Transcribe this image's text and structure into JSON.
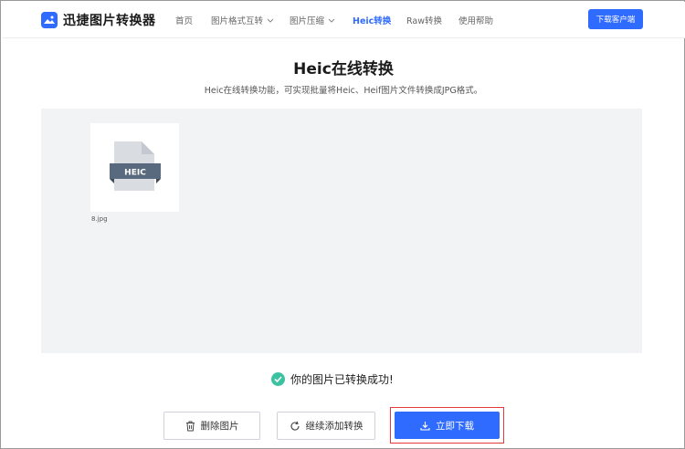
{
  "header": {
    "app_name": "迅捷图片转换器",
    "nav": [
      {
        "label": "首页",
        "has_dropdown": false,
        "active": false
      },
      {
        "label": "图片格式互转",
        "has_dropdown": true,
        "active": false
      },
      {
        "label": "图片压缩",
        "has_dropdown": true,
        "active": false
      },
      {
        "label": "Heic转换",
        "has_dropdown": false,
        "active": true
      },
      {
        "label": "Raw转换",
        "has_dropdown": false,
        "active": false
      },
      {
        "label": "使用帮助",
        "has_dropdown": false,
        "active": false
      }
    ],
    "download_client_label": "下载客户端"
  },
  "main": {
    "title": "Heic在线转换",
    "subtitle": "Heic在线转换功能，可实现批量将Heic、Heif图片文件转换成JPG格式。"
  },
  "upload": {
    "file": {
      "icon": "heic-file-icon",
      "badge": "HEIC",
      "name": "8.jpg"
    }
  },
  "status": {
    "message": "你的图片已转换成功!"
  },
  "actions": {
    "delete_label": "删除图片",
    "add_label": "继续添加转换",
    "download_label": "立即下载"
  },
  "colors": {
    "accent": "#2f6bff",
    "success": "#3cc2a1",
    "highlight_border": "#e63a3a"
  }
}
